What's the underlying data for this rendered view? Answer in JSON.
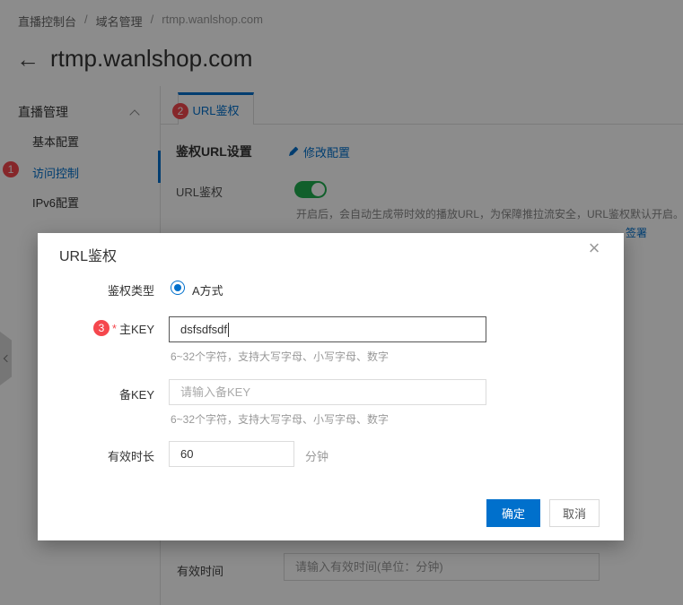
{
  "colors": {
    "accent_blue": "#0070cc",
    "badge_red": "#f5474d",
    "toggle_green": "#1fae4f"
  },
  "breadcrumb": {
    "separator": "/",
    "items": [
      "直播控制台",
      "域名管理",
      "rtmp.wanlshop.com"
    ]
  },
  "page": {
    "back_arrow": "←",
    "title": "rtmp.wanlshop.com"
  },
  "sidebar": {
    "group_label": "直播管理",
    "items": [
      {
        "label": "基本配置"
      },
      {
        "label": "访问控制",
        "badge": "1"
      },
      {
        "label": "IPv6配置"
      }
    ]
  },
  "content": {
    "tab": {
      "label": "URL鉴权",
      "badge": "2"
    },
    "section_title": "鉴权URL设置",
    "edit_link": "修改配置",
    "url_auth_label": "URL鉴权",
    "toggle_state": "on",
    "description": "开启后，会自动生成带时效的播放URL，为保障推拉流安全，URL鉴权默认开启。",
    "sign_link": "签署",
    "valid_time_label": "有效时间",
    "valid_time_placeholder": "请输入有效时间(单位：分钟)"
  },
  "modal": {
    "title": "URL鉴权",
    "close": "×",
    "auth_type": {
      "label": "鉴权类型",
      "option": "A方式",
      "selected": true
    },
    "main_key": {
      "badge": "3",
      "required_mark": "*",
      "label": "主KEY",
      "value": "dsfsdfsdf",
      "helper": "6~32个字符，支持大写字母、小写字母、数字"
    },
    "backup_key": {
      "label": "备KEY",
      "placeholder": "请输入备KEY",
      "helper": "6~32个字符，支持大写字母、小写字母、数字"
    },
    "duration": {
      "label": "有效时长",
      "value": "60",
      "unit": "分钟"
    },
    "ok": "确定",
    "cancel": "取消"
  }
}
